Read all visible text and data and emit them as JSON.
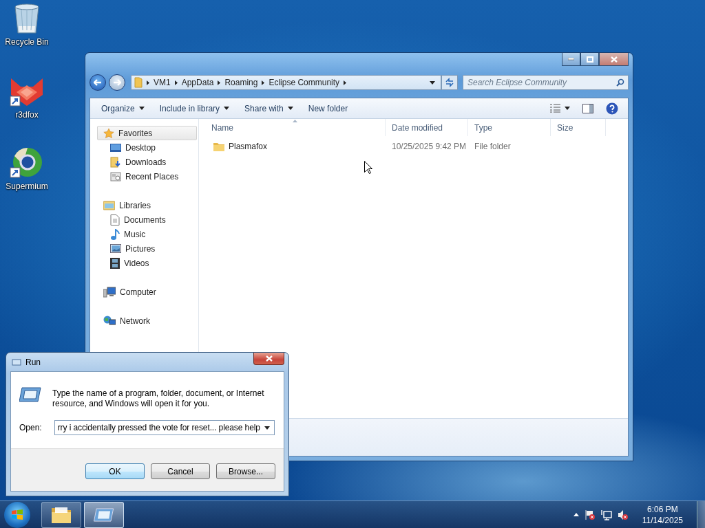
{
  "desktop_icons": [
    {
      "label": "Recycle Bin",
      "kind": "recycle"
    },
    {
      "label": "r3dfox",
      "kind": "r3dfox"
    },
    {
      "label": "Supermium",
      "kind": "supermium"
    }
  ],
  "explorer": {
    "breadcrumb": [
      "VM1",
      "AppData",
      "Roaming",
      "Eclipse Community"
    ],
    "search": {
      "placeholder": "Search Eclipse Community"
    },
    "toolbar": [
      {
        "label": "Organize",
        "dropdown": true
      },
      {
        "label": "Include in library",
        "dropdown": true
      },
      {
        "label": "Share with",
        "dropdown": true
      },
      {
        "label": "New folder",
        "dropdown": false
      }
    ],
    "nav": [
      {
        "label": "Favorites",
        "kind": "star",
        "selected": true,
        "children": [
          {
            "label": "Desktop",
            "kind": "desktop",
            "selected": false
          },
          {
            "label": "Downloads",
            "kind": "downloads",
            "selected": false
          },
          {
            "label": "Recent Places",
            "kind": "recent",
            "selected": false
          }
        ]
      },
      {
        "label": "Libraries",
        "kind": "library",
        "selected": false,
        "children": [
          {
            "label": "Documents",
            "kind": "document",
            "selected": false
          },
          {
            "label": "Music",
            "kind": "music",
            "selected": false
          },
          {
            "label": "Pictures",
            "kind": "pictures",
            "selected": false
          },
          {
            "label": "Videos",
            "kind": "video",
            "selected": false
          }
        ]
      },
      {
        "label": "Computer",
        "kind": "computer",
        "selected": false
      },
      {
        "label": "Network",
        "kind": "network",
        "selected": false
      }
    ],
    "columns": [
      "Name",
      "Date modified",
      "Type",
      "Size"
    ],
    "rows": [
      {
        "name": "Plasmafox",
        "date_modified": "10/25/2025 9:42 PM",
        "type": "File folder"
      }
    ]
  },
  "run_dialog": {
    "title": "Run",
    "description": "Type the name of a program, folder, document, or Internet resource, and Windows will open it for you.",
    "open_label": "Open:",
    "value": "rry i accidentally pressed the vote for reset... please help",
    "buttons": [
      {
        "label": "OK",
        "kind": "default"
      },
      {
        "label": "Cancel",
        "kind": "normal"
      },
      {
        "label": "Browse...",
        "kind": "normal"
      }
    ]
  },
  "taskbar": {
    "items": [
      {
        "kind": "explorer",
        "selected": false
      },
      {
        "kind": "run",
        "selected": true
      }
    ],
    "clock": {
      "time": "6:06 PM",
      "date": "11/14/2025"
    }
  }
}
